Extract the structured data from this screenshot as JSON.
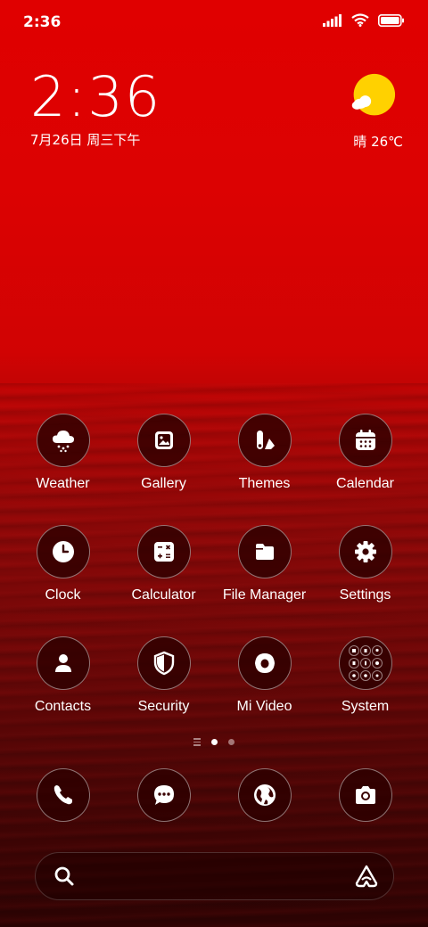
{
  "status_bar": {
    "time": "2:36"
  },
  "clock_widget": {
    "time": "2:36",
    "date": "7月26日 周三下午"
  },
  "weather_widget": {
    "summary": "晴 26℃"
  },
  "apps": [
    {
      "label": "Weather",
      "icon": "cloud-snow-icon"
    },
    {
      "label": "Gallery",
      "icon": "image-icon"
    },
    {
      "label": "Themes",
      "icon": "brush-icon"
    },
    {
      "label": "Calendar",
      "icon": "calendar-icon"
    },
    {
      "label": "Clock",
      "icon": "clock-icon"
    },
    {
      "label": "Calculator",
      "icon": "calculator-icon"
    },
    {
      "label": "File Manager",
      "icon": "folder-icon"
    },
    {
      "label": "Settings",
      "icon": "gear-icon"
    },
    {
      "label": "Contacts",
      "icon": "person-icon"
    },
    {
      "label": "Security",
      "icon": "shield-icon"
    },
    {
      "label": "Mi Video",
      "icon": "video-icon"
    },
    {
      "label": "System",
      "icon": "folder-grid-icon"
    }
  ],
  "dock": [
    {
      "icon": "phone-icon"
    },
    {
      "icon": "message-icon"
    },
    {
      "icon": "browser-icon"
    },
    {
      "icon": "camera-icon"
    }
  ],
  "pager": {
    "pages": 2,
    "active": 0
  },
  "colors": {
    "wallpaper_top": "#e00000",
    "wallpaper_bottom": "#2e0303",
    "sun": "#ffd100"
  }
}
